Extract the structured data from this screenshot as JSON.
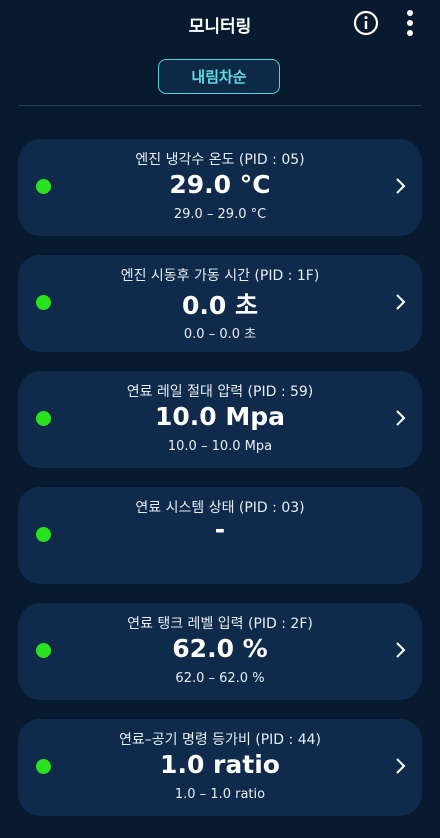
{
  "header": {
    "title": "모니터링",
    "info_icon": "info-icon",
    "menu_icon": "more-vert-icon"
  },
  "sort_button": {
    "label": "내림차순"
  },
  "colors": {
    "background": "#071a30",
    "card": "#0f2a4a",
    "accent": "#4fd0de",
    "status_ok": "#27e21d"
  },
  "items": [
    {
      "name": "엔진 냉각수 온도 (PID : 05)",
      "value": "29.0 °C",
      "range": "29.0 – 29.0 °C"
    },
    {
      "name": "엔진 시동후 가동 시간 (PID : 1F)",
      "value": "0.0 초",
      "range": "0.0 – 0.0 초"
    },
    {
      "name": "연료 레일 절대 압력 (PID : 59)",
      "value": "10.0 Mpa",
      "range": "10.0 – 10.0 Mpa"
    },
    {
      "name": "연료 시스템 상태 (PID : 03)",
      "value": "-",
      "range": ""
    },
    {
      "name": "연료 탱크 레벨 입력 (PID : 2F)",
      "value": "62.0 %",
      "range": "62.0 – 62.0 %"
    },
    {
      "name": "연료–공기 명령 등가비 (PID : 44)",
      "value": "1.0 ratio",
      "range": "1.0 – 1.0 ratio"
    }
  ]
}
